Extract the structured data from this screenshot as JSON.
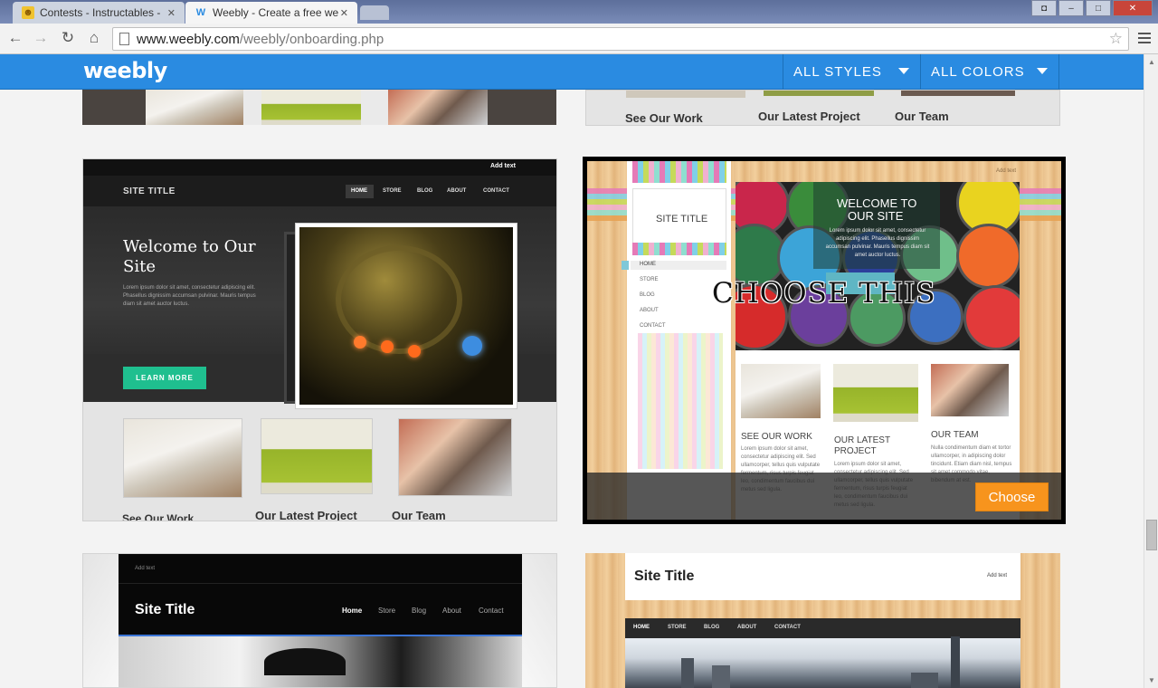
{
  "browser": {
    "tabs": [
      {
        "title": "Contests - Instructables - "
      },
      {
        "title": "Weebly - Create a free we"
      }
    ],
    "url_domain": "www.weebly.com",
    "url_path": "/weebly/onboarding.php",
    "window_buttons": {
      "minimize": "–",
      "maximize": "□",
      "close": "✕"
    }
  },
  "app": {
    "logo": "weebly",
    "filters": [
      {
        "label": "ALL STYLES"
      },
      {
        "label": "ALL COLORS"
      }
    ]
  },
  "themes": {
    "top_left_partial": {},
    "top_right_partial": {
      "labels": [
        "See Our Work",
        "Our Latest Project",
        "Our Team"
      ]
    },
    "dark_theme": {
      "add_text": "Add text",
      "site_title": "SITE TITLE",
      "nav": [
        "HOME",
        "STORE",
        "BLOG",
        "ABOUT",
        "CONTACT"
      ],
      "headline_1": "Welcome to Our",
      "headline_2": "Site",
      "body": "Lorem ipsum dolor sit amet, consectetur adipiscing elit. Phasellus dignissim accumsan pulvinar. Mauris tempus diam sit amet auctor luctus.",
      "cta": "LEARN MORE",
      "labels": [
        "See Our Work",
        "Our Latest Project",
        "Our Team"
      ]
    },
    "wood_theme": {
      "add_text": "Add text",
      "site_title": "SITE TITLE",
      "welcome_1": "WELCOME TO",
      "welcome_2": "OUR SITE",
      "welcome_body": "Lorem ipsum dolor sit amet, consectetur adipiscing elit. Phasellus dignissim accumsan pulvinar. Mauris tempus diam sit amet auctor luctus.",
      "nav": [
        "HOME",
        "STORE",
        "BLOG",
        "ABOUT",
        "CONTACT"
      ],
      "overlay_text": "CHOOSE THIS",
      "choose_button": "Choose",
      "features": [
        {
          "title": "SEE OUR WORK",
          "body": "Lorem ipsum dolor sit amet, consectetur adipiscing elit. Sed ullamcorper, tellus quis vulputate fermentum, risus turpis feugiat leo, condimentum faucibus dui metus sed ligula."
        },
        {
          "title": "OUR LATEST",
          "title2": "PROJECT",
          "body": "Lorem ipsum dolor sit amet, consectetur adipiscing elit. Sed ullamcorper, tellus quis vulputate fermentum, risus turpis feugiat leo, condimentum faucibus dui metus sed ligula."
        },
        {
          "title": "OUR TEAM",
          "body": "Nulla condimentum diam et tortor ullamcorper, in adipiscing dolor tincidunt. Etiam diam nisl, tempus sit amet commodo vitae, bibendum at est."
        }
      ]
    },
    "studio_theme": {
      "add_text": "Add text",
      "site_title": "Site Title",
      "nav": [
        "Home",
        "Store",
        "Blog",
        "About",
        "Contact"
      ]
    },
    "city_theme": {
      "site_title": "Site Title",
      "add_text": "Add text",
      "nav": [
        "HOME",
        "STORE",
        "BLOG",
        "ABOUT",
        "CONTACT"
      ]
    }
  },
  "colors": {
    "brand_blue": "#2a8be1",
    "choose_orange": "#f7941d",
    "teal_cta": "#1fbf8f"
  }
}
